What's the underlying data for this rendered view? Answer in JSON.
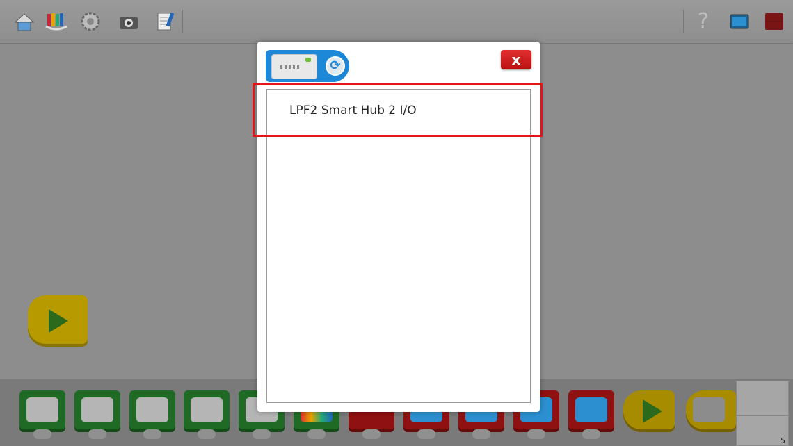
{
  "toolbar": {
    "left_icons": [
      "home-icon",
      "design-library-icon",
      "gear-icon",
      "camera-icon",
      "documentation-icon"
    ],
    "right_icons": [
      "help-icon",
      "display-icon",
      "stop-icon"
    ],
    "help_glyph": "?"
  },
  "dialog": {
    "close_label": "x",
    "refresh_glyph": "⟳",
    "devices": [
      {
        "name": "LPF2 Smart Hub 2 I/O"
      }
    ]
  },
  "palette": {
    "blocks": [
      {
        "kind": "motor-power",
        "color": "green"
      },
      {
        "kind": "motor-on-for",
        "color": "green"
      },
      {
        "kind": "motor-off",
        "color": "green"
      },
      {
        "kind": "motor-direction-ccw",
        "color": "green"
      },
      {
        "kind": "motor-direction-cw",
        "color": "green"
      },
      {
        "kind": "light",
        "color": "green"
      },
      {
        "kind": "sound",
        "color": "red"
      },
      {
        "kind": "display-background",
        "color": "red"
      },
      {
        "kind": "display-text",
        "color": "red"
      },
      {
        "kind": "display-add",
        "color": "red"
      },
      {
        "kind": "display-fullscreen",
        "color": "red"
      },
      {
        "kind": "start",
        "color": "yellow"
      },
      {
        "kind": "start-on-key",
        "color": "yellow"
      }
    ],
    "side_tile_value": "5"
  }
}
